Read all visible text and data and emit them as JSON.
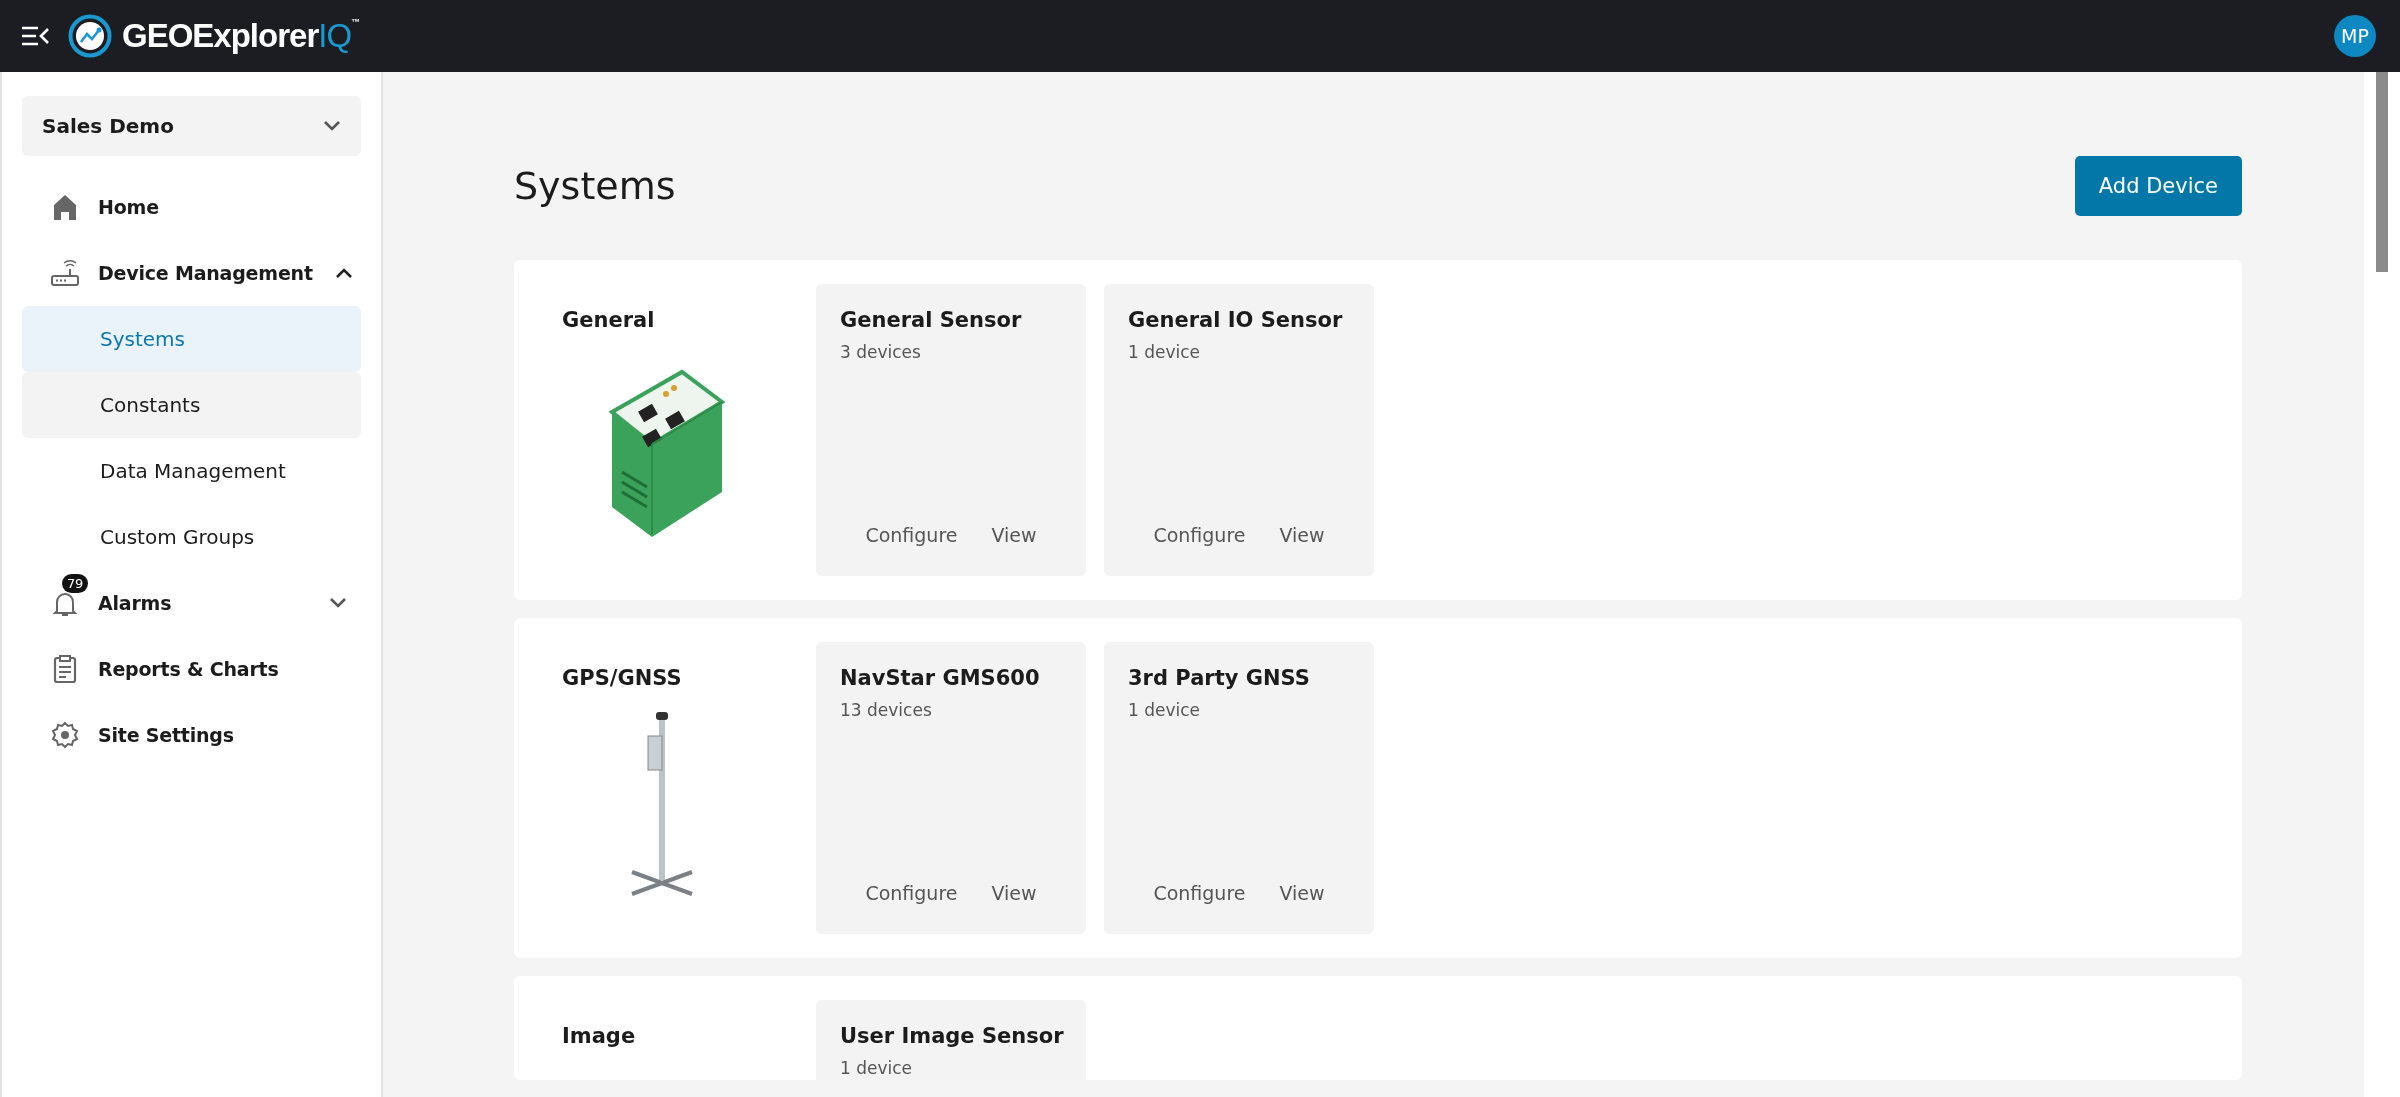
{
  "header": {
    "brand_main": "GEOExplorer",
    "brand_accent": "IQ",
    "brand_mark": "™",
    "avatar": "MP"
  },
  "sidebar": {
    "site": "Sales Demo",
    "items": [
      {
        "label": "Home"
      },
      {
        "label": "Device Management",
        "expanded": true,
        "children": [
          {
            "label": "Systems",
            "selected": true,
            "hovered": false
          },
          {
            "label": "Constants",
            "selected": false,
            "hovered": true
          },
          {
            "label": "Data Management",
            "selected": false,
            "hovered": false
          },
          {
            "label": "Custom Groups",
            "selected": false,
            "hovered": false
          }
        ]
      },
      {
        "label": "Alarms",
        "badge": "79",
        "expanded": false
      },
      {
        "label": "Reports & Charts"
      },
      {
        "label": "Site Settings"
      }
    ]
  },
  "page": {
    "title": "Systems",
    "action": "Add Device"
  },
  "groups": [
    {
      "name": "General",
      "sensors": [
        {
          "name": "General Sensor",
          "count": "3 devices",
          "actions": [
            "Configure",
            "View"
          ]
        },
        {
          "name": "General IO Sensor",
          "count": "1 device",
          "actions": [
            "Configure",
            "View"
          ]
        }
      ]
    },
    {
      "name": "GPS/GNSS",
      "sensors": [
        {
          "name": "NavStar GMS600",
          "count": "13 devices",
          "actions": [
            "Configure",
            "View"
          ]
        },
        {
          "name": "3rd Party GNSS",
          "count": "1 device",
          "actions": [
            "Configure",
            "View"
          ]
        }
      ]
    },
    {
      "name": "Image",
      "sensors": [
        {
          "name": "User Image Sensor",
          "count": "1 device"
        }
      ]
    }
  ]
}
